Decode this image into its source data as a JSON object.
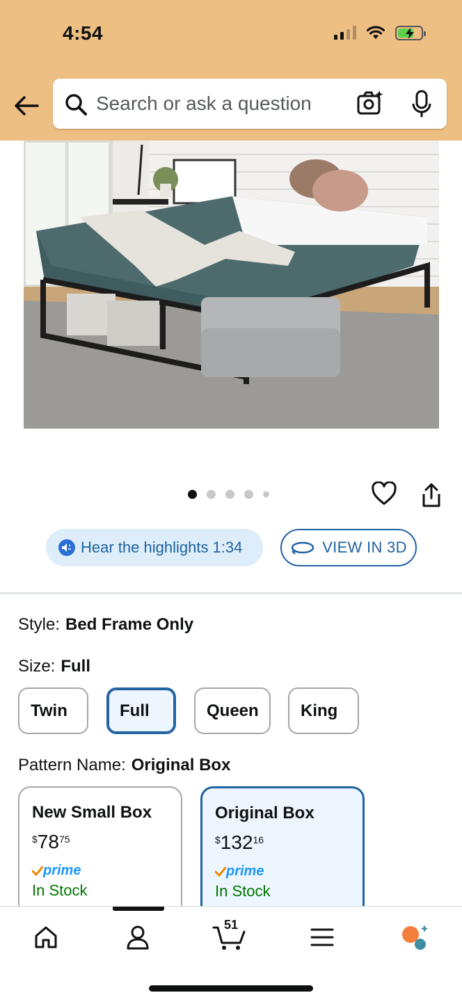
{
  "status_bar": {
    "time": "4:54"
  },
  "search": {
    "placeholder": "Search or ask a question"
  },
  "gallery": {
    "dot_count": 5,
    "active_index": 0
  },
  "audio": {
    "label": "Hear the highlights 1:34"
  },
  "view3d": {
    "label": "VIEW IN 3D"
  },
  "options": {
    "style": {
      "label": "Style:",
      "value": "Bed Frame Only"
    },
    "size": {
      "label": "Size:",
      "value": "Full",
      "choices": [
        "Twin",
        "Full",
        "Queen",
        "King"
      ],
      "selected": "Full"
    },
    "pattern": {
      "label": "Pattern Name:",
      "value": "Original Box"
    }
  },
  "pattern_cards": [
    {
      "name": "New Small Box",
      "price_symbol": "$",
      "price_whole": "78",
      "price_fraction": "75",
      "prime": "prime",
      "stock": "In Stock",
      "selected": false
    },
    {
      "name": "Original Box",
      "price_symbol": "$",
      "price_whole": "132",
      "price_fraction": "16",
      "prime": "prime",
      "stock": "In Stock",
      "selected": true
    }
  ],
  "nav": {
    "cart_count": "51"
  },
  "colors": {
    "header_bg": "#eebf82",
    "accent": "#2162a1",
    "in_stock": "#007600",
    "prime": "#1a98ff"
  },
  "icons": [
    "back-arrow-icon",
    "search-icon",
    "camera-icon",
    "microphone-icon",
    "heart-icon",
    "share-icon",
    "speaker-icon",
    "rotate-3d-icon",
    "home-icon",
    "account-icon",
    "cart-icon",
    "menu-icon",
    "rufus-icon"
  ]
}
